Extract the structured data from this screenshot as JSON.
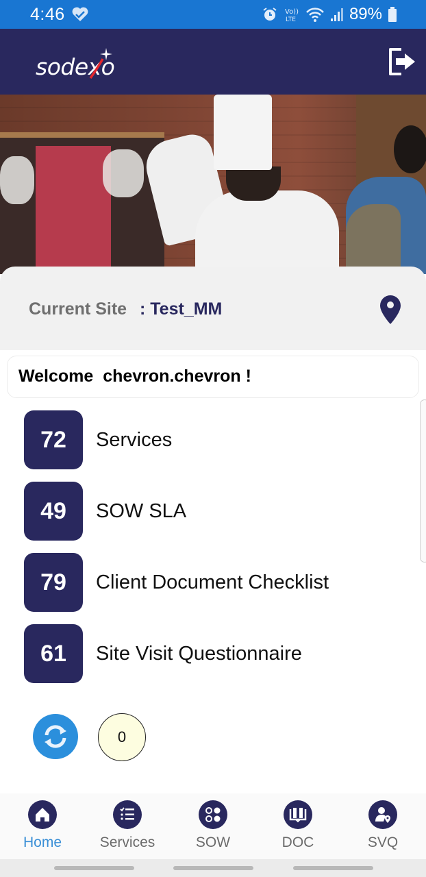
{
  "status_bar": {
    "time": "4:46",
    "battery": "89%",
    "icons": [
      "heart-check-icon",
      "alarm-icon",
      "volte-icon",
      "wifi-icon",
      "signal-icon",
      "battery-icon"
    ],
    "background_color": "#1976d2"
  },
  "header": {
    "logo_text": "sodexo",
    "logout_icon": "logout-icon",
    "background_color": "#29285e"
  },
  "site": {
    "label": "Current Site",
    "value": ": Test_MM",
    "pin_icon": "location-pin-icon"
  },
  "welcome": {
    "text": "Welcome  chevron.chevron !"
  },
  "counts": [
    {
      "count": "72",
      "label": "Services"
    },
    {
      "count": "49",
      "label": "SOW SLA"
    },
    {
      "count": "79",
      "label": "Client Document Checklist"
    },
    {
      "count": "61",
      "label": "Site Visit Questionnaire"
    }
  ],
  "sync": {
    "refresh_icon": "refresh-icon",
    "pending_count": "0"
  },
  "bottom_nav": {
    "items": [
      {
        "label": "Home",
        "icon": "home-icon",
        "active": true
      },
      {
        "label": "Services",
        "icon": "checklist-icon",
        "active": false
      },
      {
        "label": "SOW",
        "icon": "grid-circles-icon",
        "active": false
      },
      {
        "label": "DOC",
        "icon": "book-icon",
        "active": false
      },
      {
        "label": "SVQ",
        "icon": "user-location-icon",
        "active": false
      }
    ],
    "active_color": "#3a8fd6",
    "inactive_color": "#6b6b6b"
  },
  "theme": {
    "primary": "#29285e",
    "accent": "#2b8fdc"
  }
}
